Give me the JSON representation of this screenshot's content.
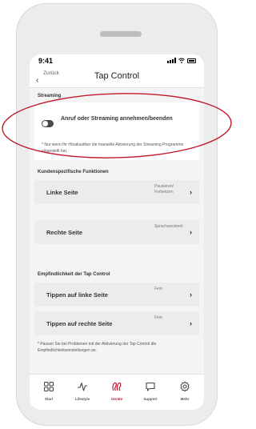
{
  "status": {
    "time": "9:41"
  },
  "nav": {
    "back_label": "Zurück",
    "title": "Tap Control"
  },
  "streaming": {
    "section_title": "Streaming",
    "toggle_label": "Anruf oder Streaming annehmen/beenden",
    "toggle_on": false,
    "note": "* Nur wenn Ihr Hörakustiker die manuelle Aktivierung der Streaming Programme eingestellt hat."
  },
  "custom": {
    "section_title": "Kundenspezifische Funktionen",
    "rows": [
      {
        "label": "Linke Seite",
        "value": "Pausieren/ Fortsetzen"
      },
      {
        "label": "Rechte Seite",
        "value": "Sprachassistent"
      }
    ]
  },
  "sensitivity": {
    "section_title": "Empfindlichkeit der Tap Control",
    "rows": [
      {
        "label": "Tippen auf linke Seite",
        "value": "Fest"
      },
      {
        "label": "Tippen auf rechte Seite",
        "value": "Fest"
      }
    ],
    "note": "* Passen Sie bei Problemen mit der Aktivierung der Tap Control die Empfindlichkeitseinstellungen an."
  },
  "tabbar": {
    "active_color": "#c8102e",
    "tabs": [
      {
        "label": "Start",
        "icon": "grid-icon"
      },
      {
        "label": "Lifestyle",
        "icon": "activity-icon"
      },
      {
        "label": "Geräte",
        "icon": "hearing-aids-icon"
      },
      {
        "label": "Support",
        "icon": "chat-icon"
      },
      {
        "label": "Mehr",
        "icon": "gear-icon"
      }
    ],
    "active_index": 2
  },
  "annotation": {
    "color": "#c0182a"
  }
}
